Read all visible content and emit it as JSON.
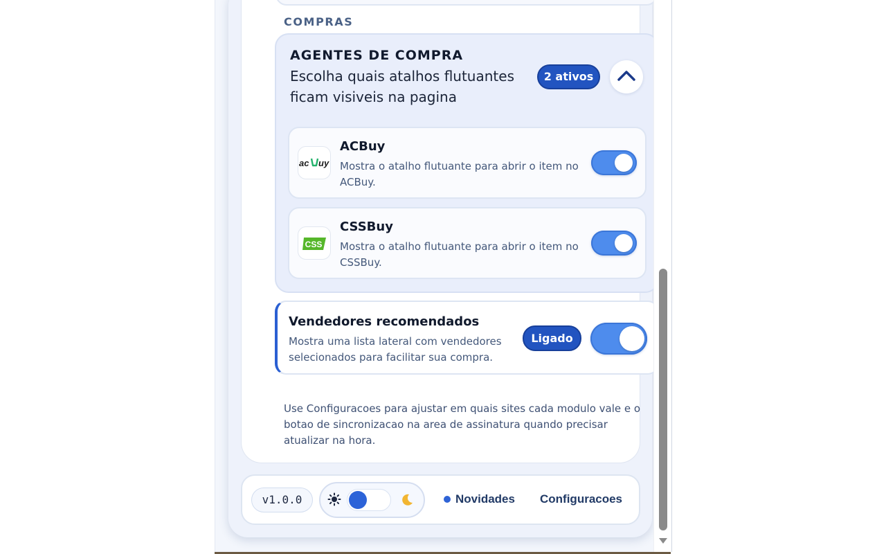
{
  "section": {
    "label": "COMPRAS"
  },
  "agents": {
    "title": "AGENTES DE COMPRA",
    "subtitle": "Escolha quais atalhos flutuantes ficam visiveis na pagina",
    "count_label": "2 ativos",
    "items": [
      {
        "name": "ACBuy",
        "description": "Mostra o atalho flutuante para abrir o item no ACBuy.",
        "logo_text": "ac",
        "logo_text_2": "uy",
        "enabled": true
      },
      {
        "name": "CSSBuy",
        "description": "Mostra o atalho flutuante para abrir o item no CSSBuy.",
        "logo_text": "CSS",
        "enabled": true
      }
    ]
  },
  "sellers": {
    "title": "Vendedores recomendados",
    "description": "Mostra uma lista lateral com vendedores selecionados para facilitar sua compra.",
    "status_label": "Ligado",
    "enabled": true
  },
  "note": "Use Configuracoes para ajustar em quais sites cada modulo vale e o botao de sincronizacao na area de assinatura quando precisar atualizar na hora.",
  "footer": {
    "version": "v1.0.0",
    "theme": "light",
    "news_label": "Novidades",
    "settings_label": "Configuracoes"
  },
  "colors": {
    "accent": "#2254c0",
    "toggle_on": "#4e8ced",
    "panel_bg": "#e9eefb"
  },
  "icons": [
    "chevron-up-icon",
    "sun-icon",
    "moon-icon",
    "acbuy-logo",
    "cssbuy-logo"
  ]
}
